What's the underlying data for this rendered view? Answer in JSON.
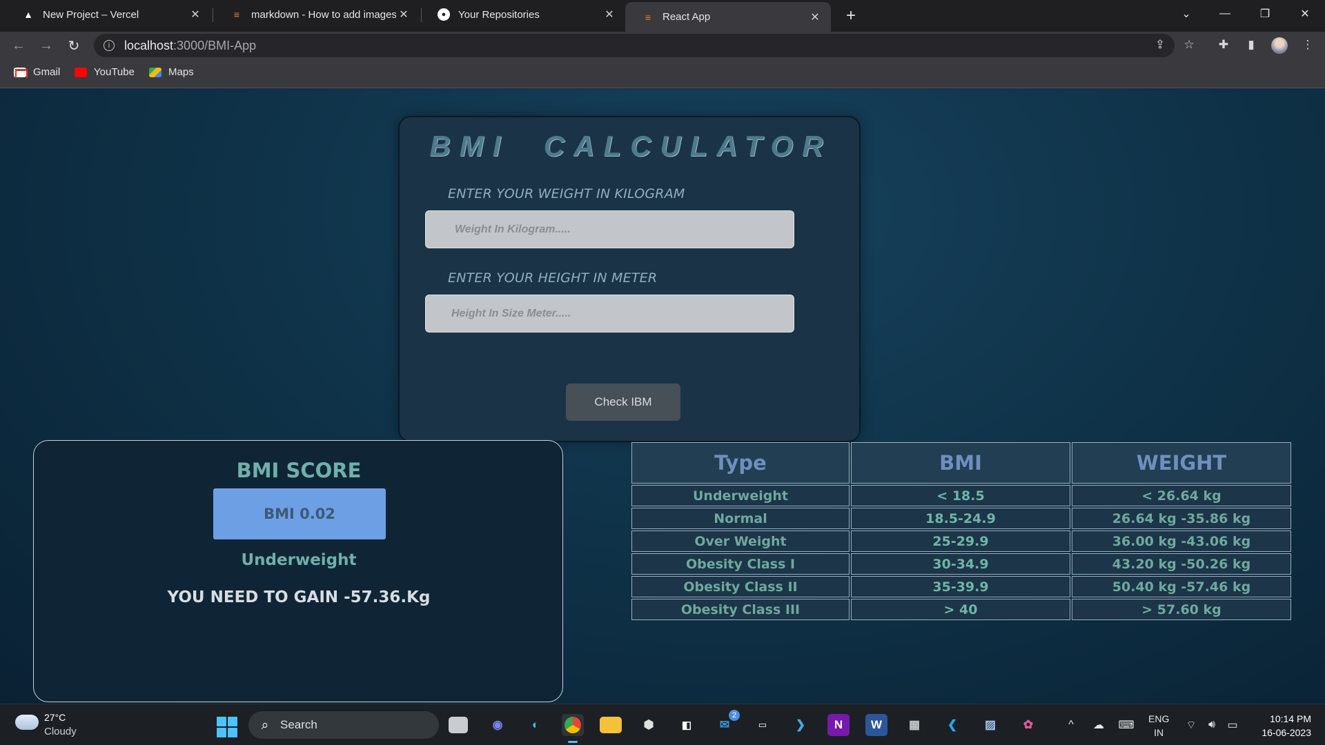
{
  "browser": {
    "tabs": [
      {
        "title": "New Project – Vercel",
        "icon": "vercel-icon",
        "active": false
      },
      {
        "title": "markdown - How to add images",
        "icon": "stackoverflow-icon",
        "active": false
      },
      {
        "title": "Your Repositories",
        "icon": "github-icon",
        "active": false
      },
      {
        "title": "React App",
        "icon": "stackoverflow-icon",
        "active": true
      }
    ],
    "url_host": "localhost",
    "url_path": ":3000/BMI-App",
    "bookmarks": [
      {
        "label": "Gmail",
        "icon": "gmail-icon"
      },
      {
        "label": "YouTube",
        "icon": "youtube-icon"
      },
      {
        "label": "Maps",
        "icon": "maps-icon"
      }
    ]
  },
  "calculator": {
    "title": "BMI  CALCULATOR",
    "weight_label": "ENTER YOUR WEIGHT IN KILOGRAM",
    "weight_placeholder": "Weight In Kilogram.....",
    "weight_value": "",
    "height_label": "ENTER YOUR HEIGHT IN METER",
    "height_placeholder": "Height In Size Meter.....",
    "height_value": "",
    "button_label": "Check IBM"
  },
  "score": {
    "title": "BMI SCORE",
    "bmi_text": "BMI 0.02",
    "category": "Underweight",
    "advice": "YOU NEED TO GAIN -57.36.Kg"
  },
  "table": {
    "headers": [
      "Type",
      "BMI",
      "WEIGHT"
    ],
    "rows": [
      [
        "Underweight",
        "< 18.5",
        "< 26.64 kg"
      ],
      [
        "Normal",
        "18.5-24.9",
        "26.64 kg -35.86 kg"
      ],
      [
        "Over Weight",
        "25-29.9",
        "36.00 kg -43.06 kg"
      ],
      [
        "Obesity Class I",
        "30-34.9",
        "43.20 kg -50.26 kg"
      ],
      [
        "Obesity Class II",
        "35-39.9",
        "50.40 kg -57.46 kg"
      ],
      [
        "Obesity Class III",
        "> 40",
        "> 57.60 kg"
      ]
    ]
  },
  "taskbar": {
    "weather_temp": "27°C",
    "weather_desc": "Cloudy",
    "search_label": "Search",
    "mail_badge": "2",
    "lang_1": "ENG",
    "lang_2": "IN",
    "time": "10:14 PM",
    "date": "16-06-2023"
  },
  "colors": {
    "page_bg": "#0f3349",
    "accent_teal": "#6fb0a8",
    "bmi_box": "#6d9fe4",
    "tab_strip": "#1f1f22"
  }
}
